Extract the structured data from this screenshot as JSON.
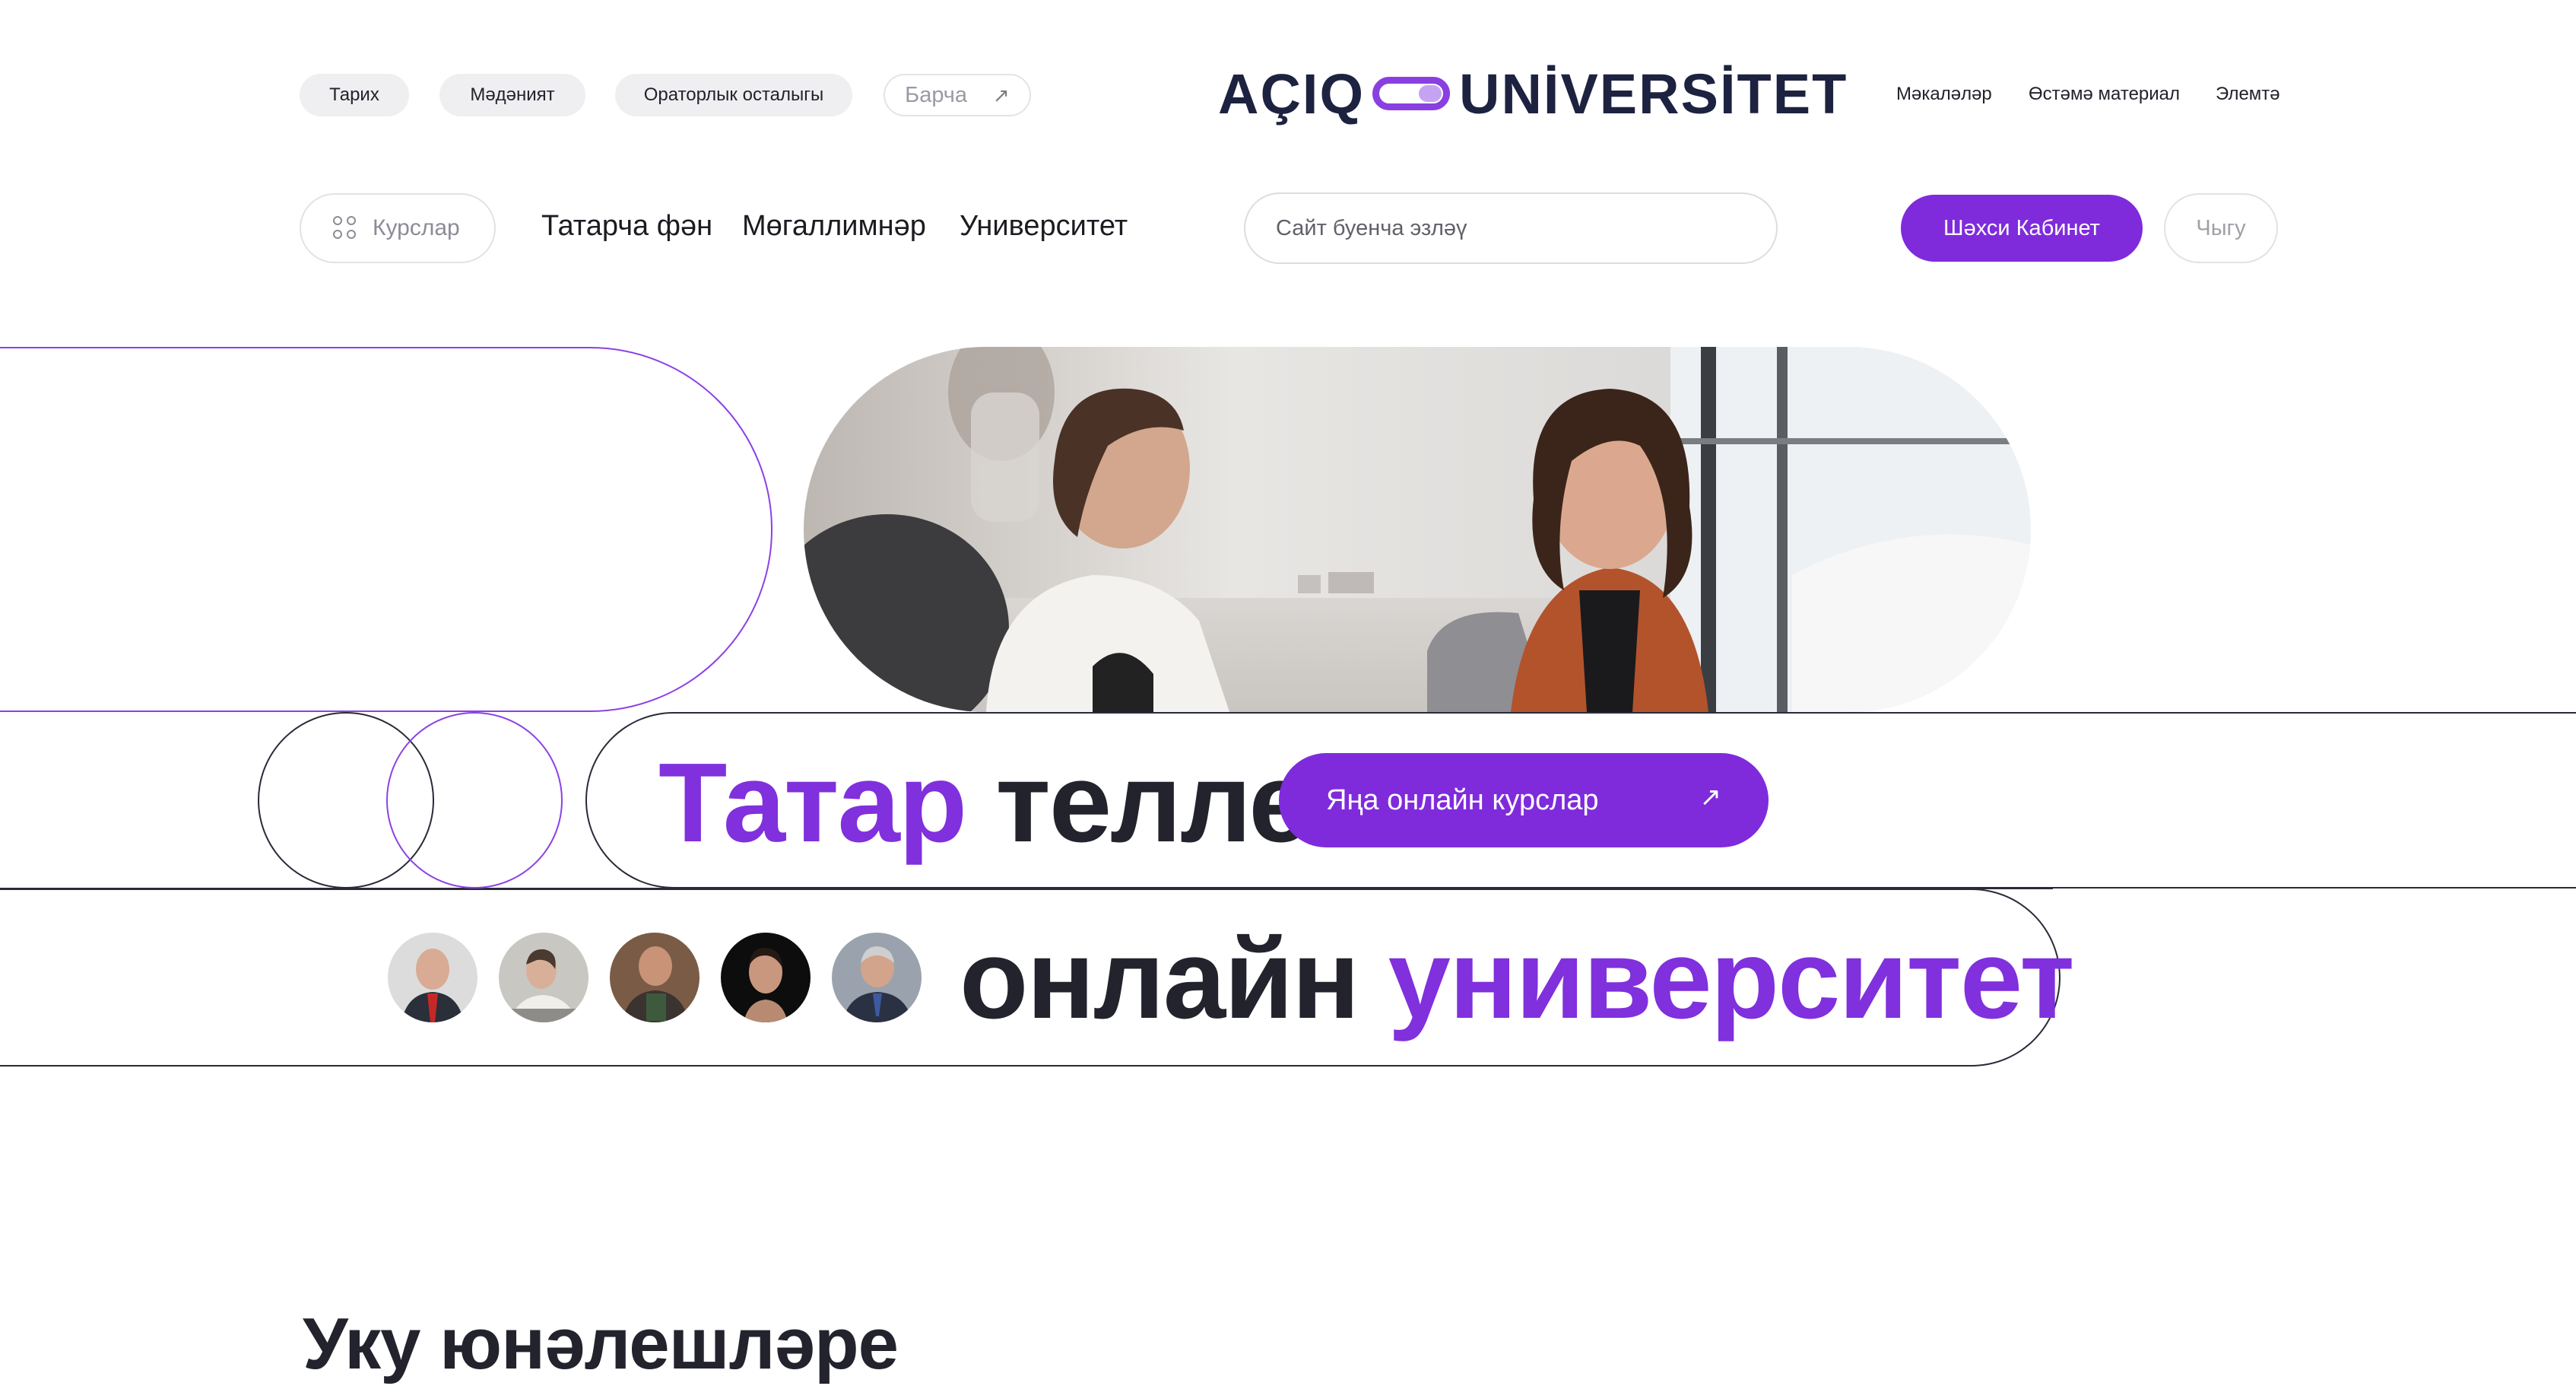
{
  "topbar": {
    "chips": [
      "Тарих",
      "Мәдәният",
      "Ораторлык осталыгы"
    ],
    "all_label": "Барча",
    "all_icon": "arrow-up-right-icon",
    "links": [
      "Мәкаләләр",
      "Өстәмә материал",
      "Элемтә"
    ]
  },
  "logo": {
    "left": "AÇIQ",
    "right": "UNİVERSİTET",
    "brand_color": "#8030dc"
  },
  "nav": {
    "courses_label": "Курслар",
    "courses_icon": "grid-icon",
    "items": [
      "Татарча фән",
      "Мөгаллимнәр",
      "Университет"
    ],
    "search_placeholder": "Сайт буенча эзләү",
    "cabinet_label": "Шәхси Кабинет",
    "logout_label": "Чыгу"
  },
  "hero": {
    "title_word1": "Татар",
    "title_word2": "телле",
    "title_word3": "онлайн",
    "title_word4": "университет",
    "cta_label": "Яңа онлайн курслар",
    "cta_icon": "arrow-up-right-icon",
    "accent": "#8030dc",
    "dark": "#23232d"
  },
  "section": {
    "title": "Уку юнәлешләре"
  }
}
